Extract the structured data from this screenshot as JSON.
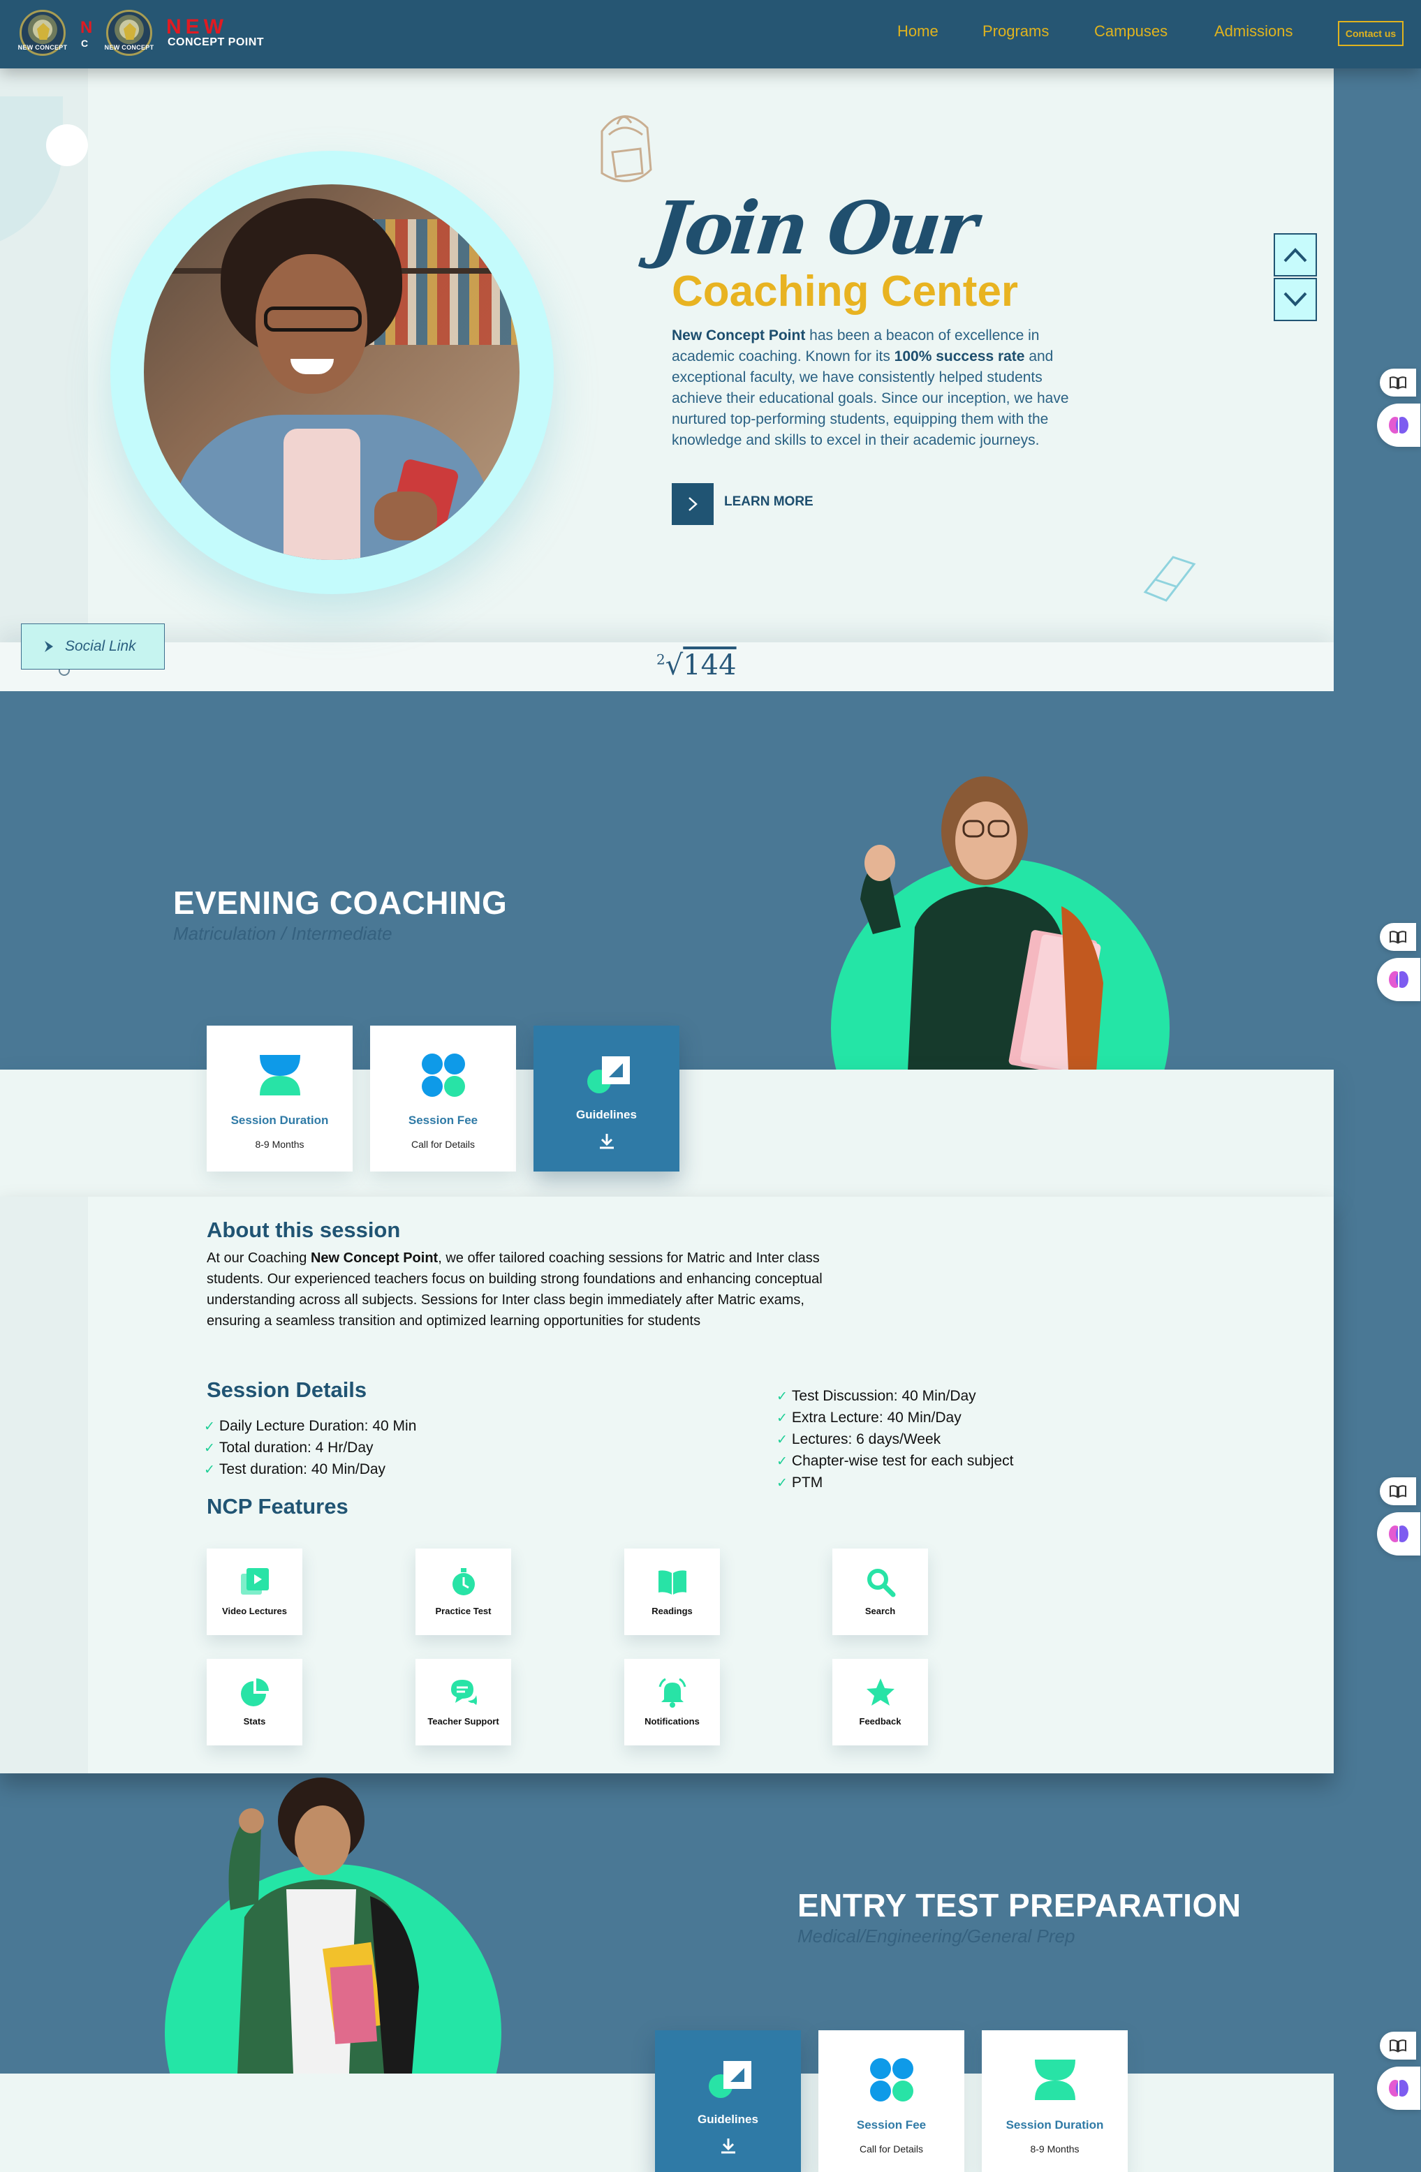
{
  "header": {
    "logo_small_text": "NEW CONCEPT",
    "brand_fragment_red": "N",
    "brand_fragment_white": "C",
    "brand_new": "NEW",
    "brand_cp": "CONCEPT POINT",
    "nav": [
      "Home",
      "Programs",
      "Campuses",
      "Admissions"
    ],
    "contact_label": "Contact us"
  },
  "hero": {
    "title_script": "Join Our",
    "title": "Coaching Center",
    "para": {
      "brand": "New Concept Point",
      "t1": " has been a beacon of excellence in academic coaching. Known for its ",
      "highlight": "100% success rate",
      "t2": " and exceptional faculty, we have consistently helped students achieve their educational goals. Since our inception, we have nurtured top-performing students, equipping them with the knowledge and skills to excel in their academic journeys."
    },
    "learn_more": "LEARN MORE",
    "sqrt_index": "2",
    "sqrt_value": "144",
    "social_link": "Social Link"
  },
  "evening": {
    "title": "EVENING COACHING",
    "subtitle": "Matriculation / Intermediate",
    "cards": [
      {
        "title": "Session Duration",
        "value": "8-9 Months",
        "icon": "hourglass-icon"
      },
      {
        "title": "Session Fee",
        "value": "Call for Details",
        "icon": "four-circles-icon"
      },
      {
        "title": "Guidelines",
        "value": "",
        "icon": "guidelines-icon"
      }
    ]
  },
  "about": {
    "heading": "About this session",
    "para_prefix": "At our Coaching ",
    "para_brand": "New Concept Point",
    "para_rest": ", we offer tailored coaching sessions for Matric and Inter class students. Our experienced teachers focus on building strong foundations and enhancing conceptual understanding across all subjects. Sessions for Inter class begin immediately after Matric exams, ensuring a seamless transition and optimized learning opportunities for students",
    "details_heading": "Session Details",
    "details_left": [
      "Daily Lecture Duration: 40 Min",
      "Total duration: 4 Hr/Day",
      "Test duration: 40 Min/Day"
    ],
    "details_right": [
      "Test Discussion: 40 Min/Day",
      "Extra Lecture: 40 Min/Day",
      "Lectures: 6 days/Week",
      "Chapter-wise test for each subject",
      "PTM"
    ],
    "features_heading": "NCP Features",
    "features": [
      {
        "label": "Video Lectures",
        "icon": "video-icon"
      },
      {
        "label": "Practice Test",
        "icon": "stopwatch-icon"
      },
      {
        "label": "Readings",
        "icon": "book-icon"
      },
      {
        "label": "Search",
        "icon": "search-icon"
      },
      {
        "label": "Stats",
        "icon": "pie-chart-icon"
      },
      {
        "label": "Teacher Support",
        "icon": "chat-icon"
      },
      {
        "label": "Notifications",
        "icon": "bell-icon"
      },
      {
        "label": "Feedback",
        "icon": "star-icon"
      }
    ]
  },
  "entry": {
    "title": "ENTRY TEST PREPARATION",
    "subtitle": "Medical/Engineering/General Prep",
    "cards": [
      {
        "title": "Guidelines",
        "value": "",
        "icon": "guidelines-icon"
      },
      {
        "title": "Session Fee",
        "value": "Call for Details",
        "icon": "four-circles-icon"
      },
      {
        "title": "Session Duration",
        "value": "8-9 Months",
        "icon": "hourglass-icon"
      }
    ]
  },
  "colors": {
    "header_bg": "#265673",
    "section_blue": "#4a7895",
    "accent_yellow": "#e8b321",
    "accent_green": "#24e5a6",
    "card_blue": "#2f7aa6",
    "light_bg": "#edf6f4"
  }
}
